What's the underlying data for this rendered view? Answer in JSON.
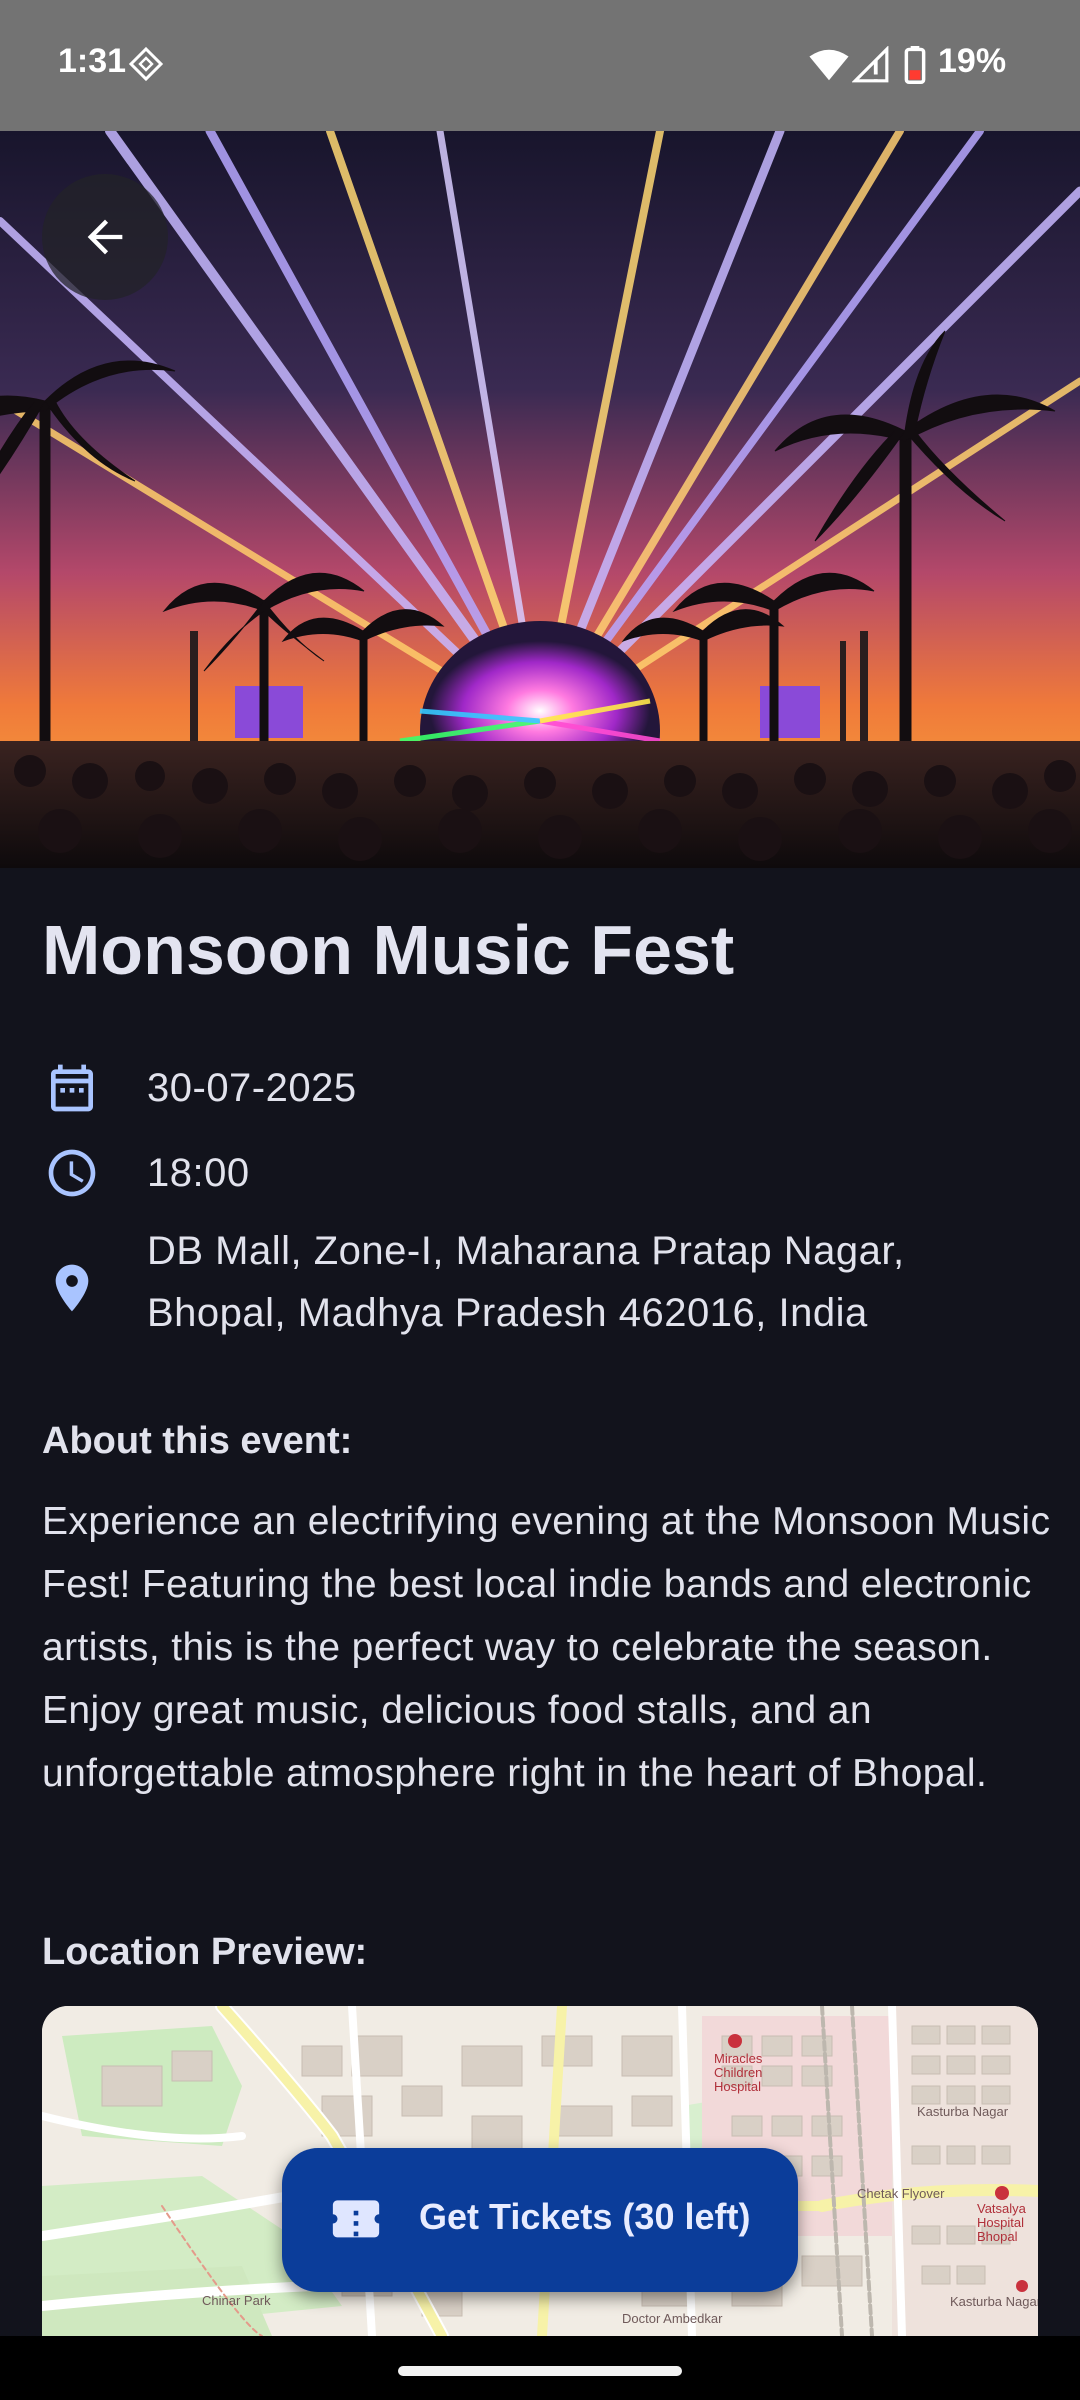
{
  "status_bar": {
    "time": "1:31",
    "battery_percent": "19%",
    "icons": [
      "diamond-notification-icon",
      "wifi-icon",
      "signal-icon",
      "battery-low-icon"
    ]
  },
  "hero": {
    "image": "concert-stage-with-laser-lights-and-palm-trees",
    "back_icon": "arrow-left-icon"
  },
  "event": {
    "title": "Monsoon Music Fest",
    "date": "30-07-2025",
    "time": "18:00",
    "address_line1": "DB Mall, Zone-I, Maharana Pratap Nagar,",
    "address_line2": "Bhopal, Madhya Pradesh 462016, India"
  },
  "about": {
    "heading": "About this event:",
    "body": "Experience an electrifying evening at the Monsoon Music Fest! Featuring the best local indie bands and electronic artists, this is the perfect way to celebrate the season. Enjoy great music, delicious food stalls, and an unforgettable atmosphere right in the heart of Bhopal."
  },
  "location": {
    "heading": "Location Preview:",
    "map_labels": {
      "hospital": "Miracles Children Hospital",
      "kasturba_nagar": "Kasturba Nagar",
      "chetak_flyover": "Chetak Flyover",
      "vatsalya_hospital": "Vatsalya Hospital Bhopal",
      "kasturba_nagar_2": "Kasturba Nagar",
      "chinar_park": "Chinar Park",
      "doctor_ambedkar": "Doctor Ambedkar"
    }
  },
  "tickets_button": {
    "label": "Get Tickets (30 left)",
    "icon": "ticket-icon"
  },
  "colors": {
    "background": "#12131c",
    "button": "#0b3d9a",
    "icon_accent": "#a9c4ff",
    "status_bar": "#737373"
  }
}
